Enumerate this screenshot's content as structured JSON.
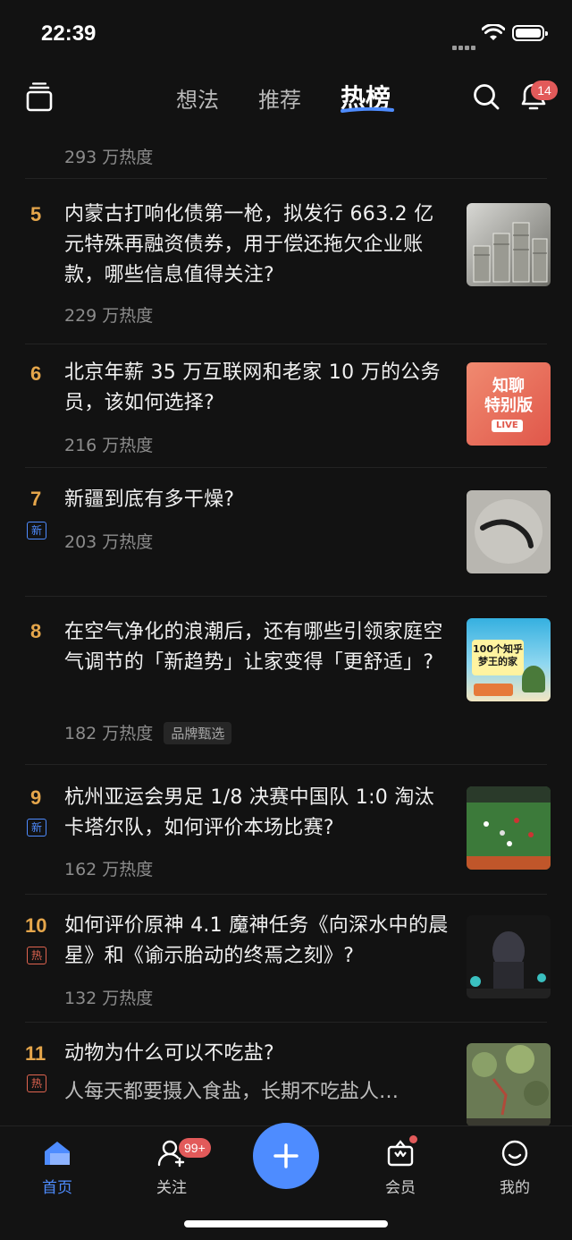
{
  "status_bar": {
    "time": "22:39"
  },
  "top_nav": {
    "tabs": [
      {
        "label": "想法",
        "active": false
      },
      {
        "label": "推荐",
        "active": false
      },
      {
        "label": "热榜",
        "active": true
      }
    ],
    "notification_count": "14"
  },
  "colors": {
    "accent": "#4e8cff",
    "rank": "#e5a64b",
    "badge": "#e25a5a",
    "hot_tag": "#e06450"
  },
  "hot_list": {
    "partial_item_heat": "293 万热度",
    "items": [
      {
        "rank": "5",
        "title": "内蒙古打响化债第一枪，拟发行 663.2 亿元特殊再融资债券，用于偿还拖欠企业账款，哪些信息值得关注?",
        "heat": "229 万热度"
      },
      {
        "rank": "6",
        "title": "北京年薪 35 万互联网和老家 10 万的公务员，该如何选择?",
        "heat": "216 万热度",
        "thumb_text": [
          "知聊",
          "特别版"
        ],
        "thumb_live": "LIVE"
      },
      {
        "rank": "7",
        "tag": "新",
        "title": "新疆到底有多干燥?",
        "heat": "203 万热度"
      },
      {
        "rank": "8",
        "title": "在空气净化的浪潮后，还有哪些引领家庭空气调节的「新趋势」让家变得「更舒适」?",
        "heat": "182 万热度",
        "badge": "品牌甄选",
        "thumb_text": [
          "100个知乎",
          "梦王的家"
        ]
      },
      {
        "rank": "9",
        "tag": "新",
        "title": "杭州亚运会男足 1/8 决赛中国队 1:0 淘汰卡塔尔队，如何评价本场比赛?",
        "heat": "162 万热度"
      },
      {
        "rank": "10",
        "tag": "热",
        "title": "如何评价原神 4.1 魔神任务《向深水中的晨星》和《谕示胎动的终焉之刻》?",
        "heat": "132 万热度"
      },
      {
        "rank": "11",
        "tag": "热",
        "title": "动物为什么可以不吃盐?",
        "excerpt": "人每天都要摄入食盐，长期不吃盐人…"
      }
    ]
  },
  "tab_bar": {
    "items": [
      {
        "label": "首页",
        "icon": "home-icon",
        "active": true
      },
      {
        "label": "关注",
        "icon": "follow-icon",
        "badge": "99+"
      },
      {
        "label": "",
        "icon": "plus-icon"
      },
      {
        "label": "会员",
        "icon": "vip-icon"
      },
      {
        "label": "我的",
        "icon": "profile-icon"
      }
    ]
  }
}
